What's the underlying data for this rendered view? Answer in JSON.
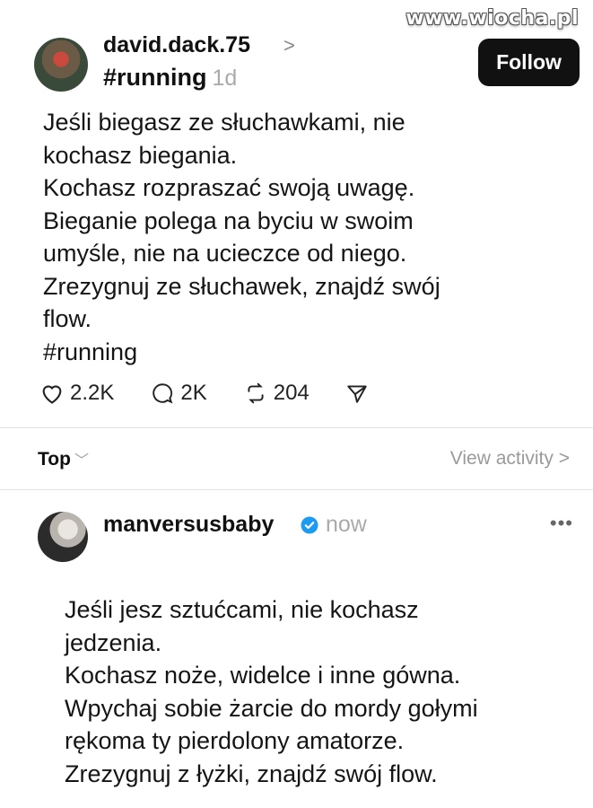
{
  "watermark": "www.wiocha.pl",
  "post": {
    "username": "david.dack.75",
    "username_chevron": ">",
    "tag": "#running",
    "time_ago": "1d",
    "follow_label": "Follow",
    "lines": [
      "Jeśli biegasz ze słuchawkami, nie",
      "kochasz biegania.",
      "Kochasz rozpraszać swoją uwagę.",
      "Bieganie polega na byciu w swoim",
      "umyśle, nie na ucieczce od niego.",
      "Zrezygnuj ze słuchawek, znajdź swój",
      "flow.",
      "#running"
    ],
    "likes": "2.2K",
    "comments": "2K",
    "reposts": "204"
  },
  "sort": {
    "label": "Top",
    "view_activity": "View activity",
    "view_activity_chevron": ">"
  },
  "reply": {
    "username": "manversusbaby",
    "time_ago": "now",
    "more": "•••",
    "lines": [
      "Jeśli jesz sztućcami, nie kochasz",
      "jedzenia.",
      "Kochasz noże, widelce i inne gówna.",
      "Wpychaj sobie żarcie do mordy gołymi",
      "rękoma ty pierdolony amatorze.",
      "Zrezygnuj z łyżki, znajdź swój flow."
    ]
  },
  "colors": {
    "verified": "#1d9bf0",
    "follow_bg": "#111111",
    "muted": "#aaaaaa"
  }
}
